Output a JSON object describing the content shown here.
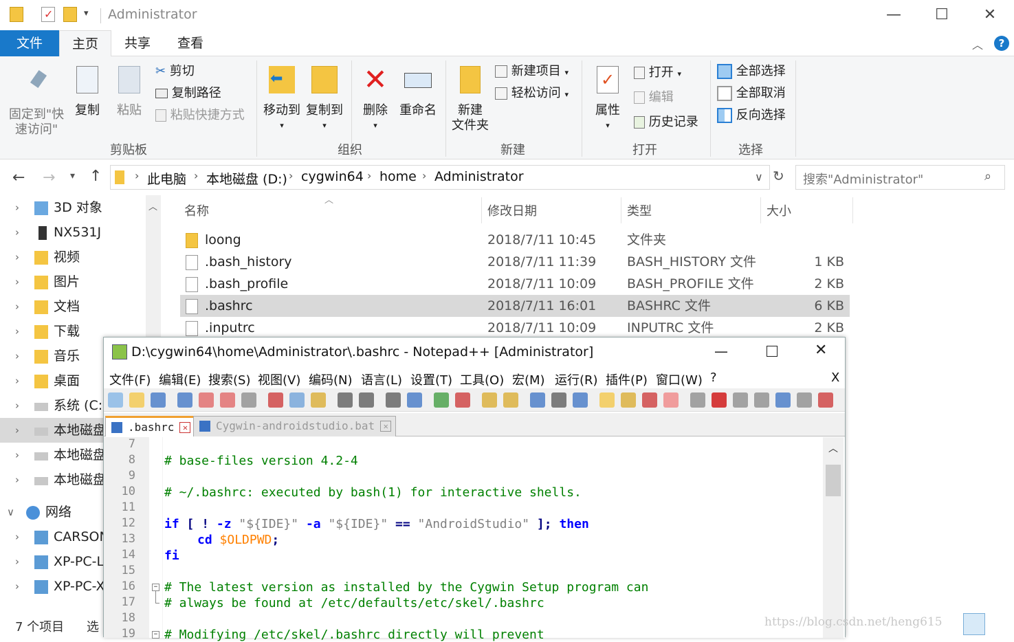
{
  "titlebar": {
    "title": "Administrator",
    "minimize": "—",
    "maximize": "☐",
    "close": "✕"
  },
  "ribbon_tabs": {
    "file": "文件",
    "home": "主页",
    "share": "共享",
    "view": "查看"
  },
  "ribbon": {
    "clipboard": {
      "pin": "固定到\"快\n速访问\"",
      "copy": "复制",
      "paste": "粘贴",
      "cut": "剪切",
      "copy_path": "复制路径",
      "paste_shortcut": "粘贴快捷方式",
      "label": "剪贴板"
    },
    "organize": {
      "move_to": "移动到",
      "copy_to": "复制到",
      "delete": "删除",
      "rename": "重命名",
      "label": "组织"
    },
    "new": {
      "new_folder": "新建\n文件夹",
      "new_item": "新建项目",
      "easy_access": "轻松访问",
      "label": "新建"
    },
    "open": {
      "properties": "属性",
      "open": "打开",
      "edit": "编辑",
      "history": "历史记录",
      "label": "打开"
    },
    "select": {
      "select_all": "全部选择",
      "select_none": "全部取消",
      "invert": "反向选择",
      "label": "选择"
    }
  },
  "address": {
    "crumbs": [
      "此电脑",
      "本地磁盘 (D:)",
      "cygwin64",
      "home",
      "Administrator"
    ],
    "search_placeholder": "搜索\"Administrator\""
  },
  "nav": {
    "items": [
      "3D 对象",
      "NX531J",
      "视频",
      "图片",
      "文档",
      "下载",
      "音乐",
      "桌面",
      "系统 (C:)",
      "本地磁盘",
      "本地磁盘",
      "本地磁盘",
      "网络",
      "CARSON",
      "XP-PC-L",
      "XP-PC-X"
    ]
  },
  "columns": {
    "name": "名称",
    "date": "修改日期",
    "type": "类型",
    "size": "大小"
  },
  "files": [
    {
      "name": "loong",
      "date": "2018/7/11 10:45",
      "type": "文件夹",
      "size": ""
    },
    {
      "name": ".bash_history",
      "date": "2018/7/11 11:39",
      "type": "BASH_HISTORY 文件",
      "size": "1 KB"
    },
    {
      "name": ".bash_profile",
      "date": "2018/7/11 10:09",
      "type": "BASH_PROFILE 文件",
      "size": "2 KB"
    },
    {
      "name": ".bashrc",
      "date": "2018/7/11 16:01",
      "type": "BASHRC 文件",
      "size": "6 KB"
    },
    {
      "name": ".inputrc",
      "date": "2018/7/11 10:09",
      "type": "INPUTRC 文件",
      "size": "2 KB"
    }
  ],
  "status": {
    "count": "7 个项目",
    "selected": "选"
  },
  "npp": {
    "title": "D:\\cygwin64\\home\\Administrator\\.bashrc - Notepad++ [Administrator]",
    "menu": [
      "文件(F)",
      "编辑(E)",
      "搜索(S)",
      "视图(V)",
      "编码(N)",
      "语言(L)",
      "设置(T)",
      "工具(O)",
      "宏(M)",
      "运行(R)",
      "插件(P)",
      "窗口(W)",
      "?"
    ],
    "menu_close": "X",
    "tabs": [
      ".bashrc",
      "Cygwin-androidstudio.bat"
    ],
    "line_numbers": [
      "7",
      "8",
      "9",
      "10",
      "11",
      "12",
      "13",
      "14",
      "15",
      "16",
      "17",
      "18",
      "19"
    ],
    "lines": {
      "l8": "# base-files version 4.2-4",
      "l10": "# ~/.bashrc: executed by bash(1) for interactive shells.",
      "l12_if": "if",
      "l12_b1": " [ ! ",
      "l12_z": "-z",
      "l12_s1": " \"${IDE}\" ",
      "l12_a": "-a",
      "l12_s2": " \"${IDE}\" ",
      "l12_eq": "==",
      "l12_s3": " \"AndroidStudio\" ",
      "l12_b2": "]; ",
      "l12_then": "then",
      "l13_cd": "cd",
      "l13_var": "$OLDPWD",
      "l13_semi": ";",
      "l14": "fi",
      "l16": "# The latest version as installed by the Cygwin Setup program can",
      "l17": "# always be found at /etc/defaults/etc/skel/.bashrc",
      "l19": "# Modifying /etc/skel/.bashrc directly will prevent"
    }
  },
  "watermark": "https://blog.csdn.net/heng615"
}
